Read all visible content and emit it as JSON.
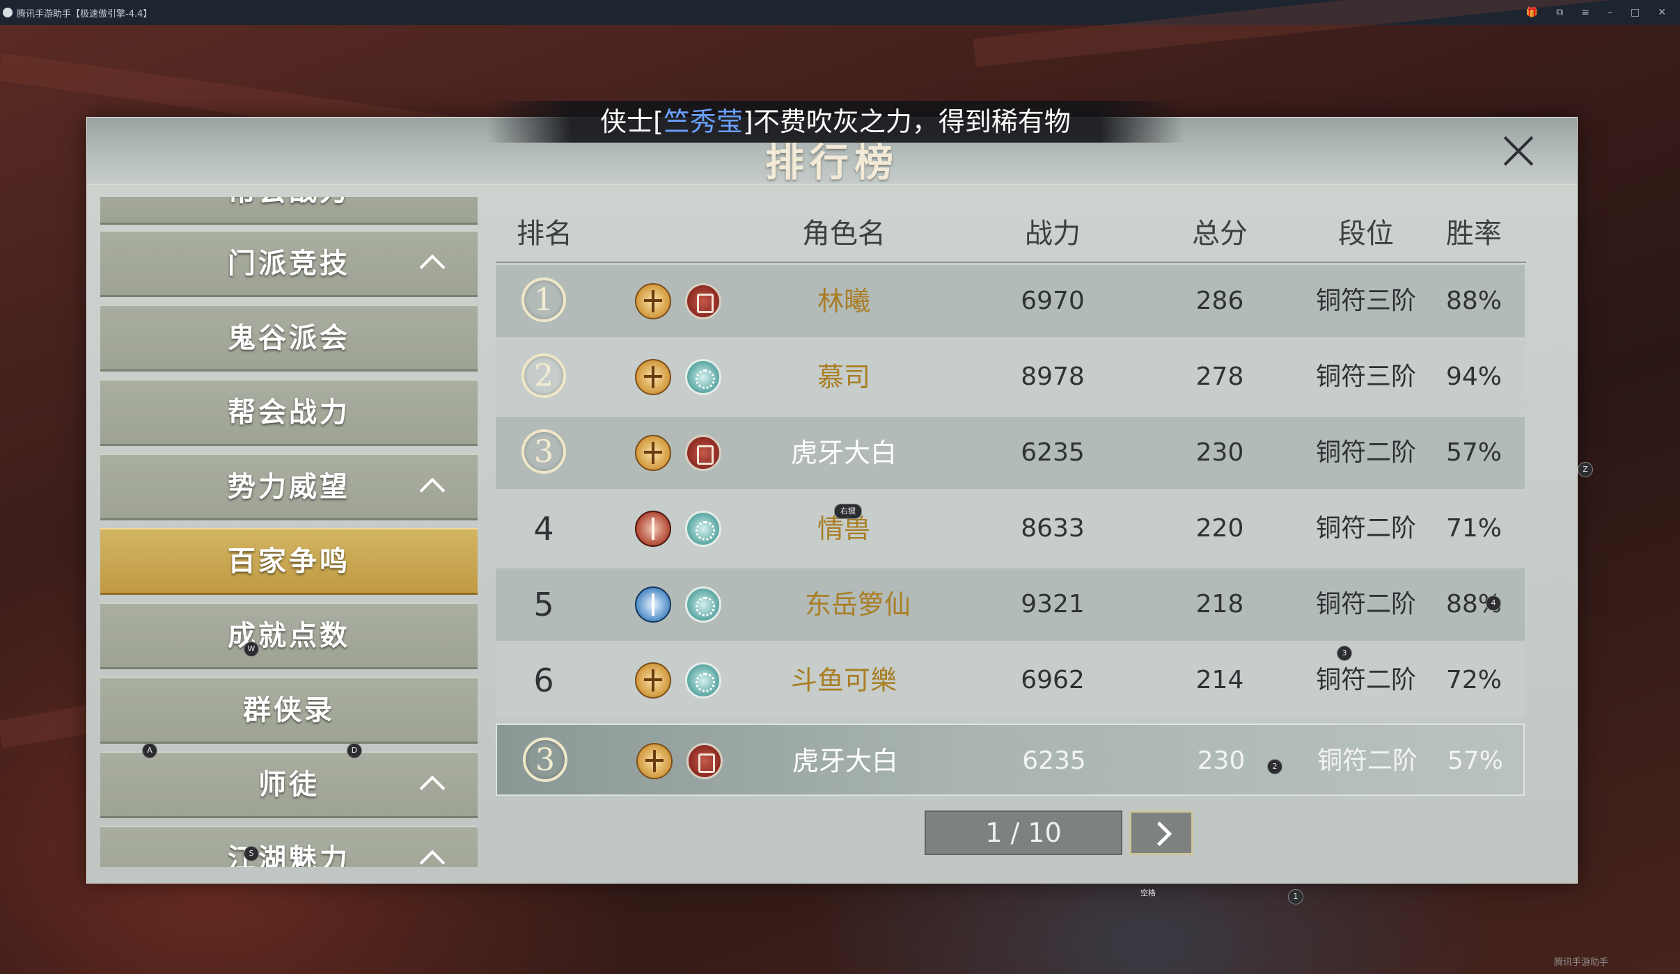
{
  "window": {
    "title": "腾讯手游助手【极速傲引擎-4.4】"
  },
  "banner": {
    "prefix": "侠士[",
    "player": "竺秀莹",
    "suffix": "]不费吹灰之力，得到稀有物"
  },
  "panel": {
    "title": "排行榜"
  },
  "sidebar": {
    "items": [
      {
        "label": "帮会战力",
        "partial": true
      },
      {
        "label": "门派竞技",
        "expandable": true
      },
      {
        "label": "鬼谷派会"
      },
      {
        "label": "帮会战力"
      },
      {
        "label": "势力威望",
        "expandable": true
      },
      {
        "label": "百家争鸣",
        "active": true
      },
      {
        "label": "成就点数"
      },
      {
        "label": "群侠录"
      },
      {
        "label": "师徒",
        "expandable": true
      },
      {
        "label": "江湖魅力",
        "expandable": true
      }
    ]
  },
  "table": {
    "headers": {
      "rank": "排名",
      "name": "角色名",
      "power": "战力",
      "score": "总分",
      "tier": "段位",
      "winrate": "胜率"
    },
    "rows": [
      {
        "rank": "1",
        "name": "林曦",
        "power": "6970",
        "score": "286",
        "tier": "铜符三阶",
        "winrate": "88%"
      },
      {
        "rank": "2",
        "name": "慕司",
        "power": "8978",
        "score": "278",
        "tier": "铜符三阶",
        "winrate": "94%"
      },
      {
        "rank": "3",
        "name": "虎牙大白",
        "power": "6235",
        "score": "230",
        "tier": "铜符二阶",
        "winrate": "57%"
      },
      {
        "rank": "4",
        "name": "情兽",
        "power": "8633",
        "score": "220",
        "tier": "铜符二阶",
        "winrate": "71%"
      },
      {
        "rank": "5",
        "name": "东岳箩仙",
        "power": "9321",
        "score": "218",
        "tier": "铜符二阶",
        "winrate": "88%"
      },
      {
        "rank": "6",
        "name": "斗鱼可樂",
        "power": "6962",
        "score": "214",
        "tier": "铜符二阶",
        "winrate": "72%"
      }
    ],
    "self_row": {
      "rank": "3",
      "name": "虎牙大白",
      "power": "6235",
      "score": "230",
      "tier": "铜符二阶",
      "winrate": "57%"
    }
  },
  "pagination": {
    "text": "1 / 10"
  },
  "key_hints": {
    "right_click": "右键",
    "space": "空格",
    "w": "W",
    "a": "A",
    "d": "D",
    "s": "S",
    "z": "Z",
    "k1": "1",
    "k2": "2",
    "k3": "3",
    "k4": "4"
  },
  "watermark": "腾讯手游助手",
  "colors": {
    "gold_name": "#a97e25",
    "active_tab": "#c9a54f",
    "banner_name": "#6aa0ff"
  }
}
